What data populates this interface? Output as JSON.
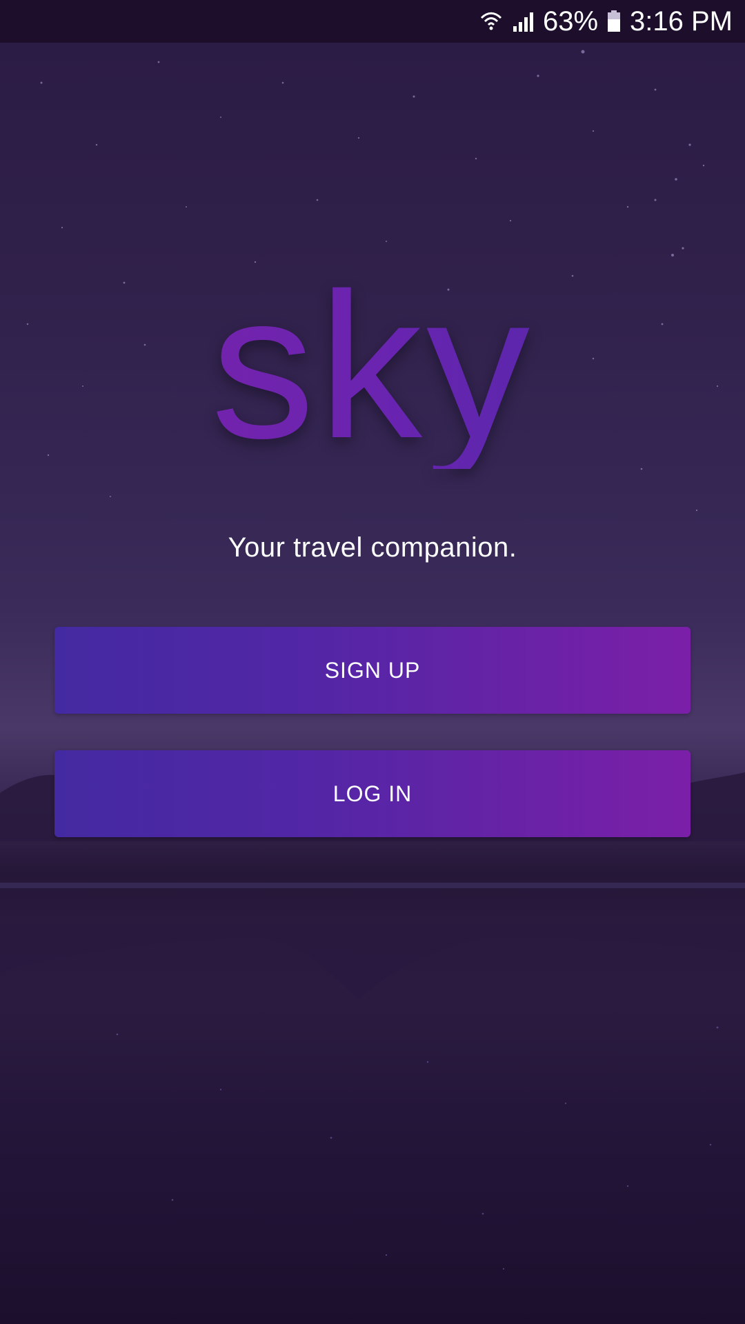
{
  "status_bar": {
    "battery_percent": "63%",
    "time": "3:16 PM",
    "icons": [
      "wifi-icon",
      "signal-icon",
      "battery-icon"
    ]
  },
  "app": {
    "logo_text": "sky",
    "tagline": "Your travel companion."
  },
  "actions": {
    "signup_label": "SIGN UP",
    "login_label": "LOG IN"
  },
  "colors": {
    "background": "#2a1b44",
    "button_gradient_start": "#442aa2",
    "button_gradient_end": "#7b1fa8",
    "logo_color": "#7a26b0"
  }
}
